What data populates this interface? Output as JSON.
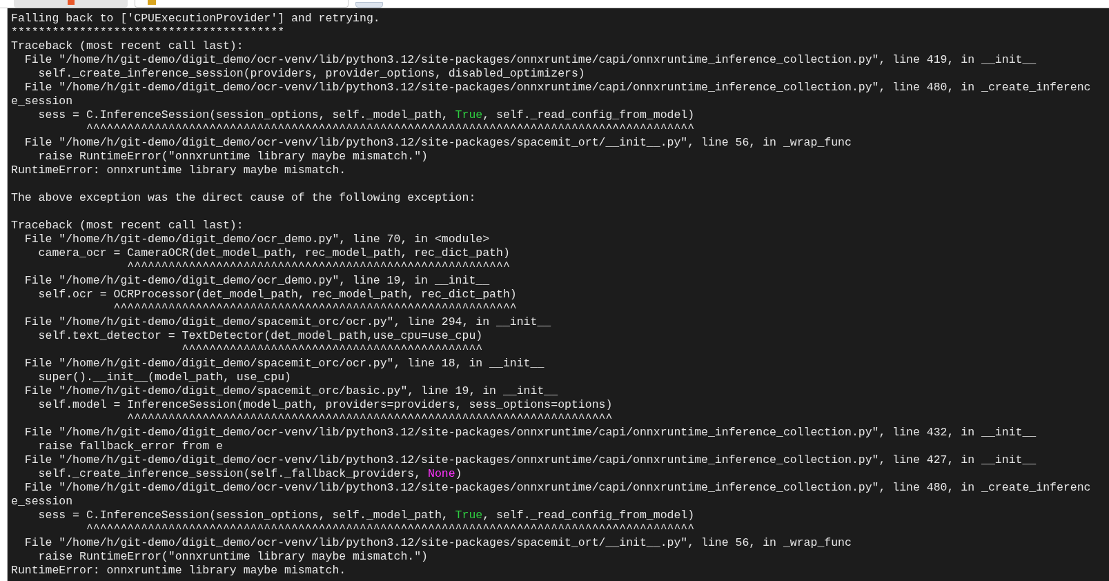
{
  "terminal": {
    "lines": [
      {
        "kind": "text",
        "parts": [
          {
            "text": "Falling back to ['CPUExecutionProvider'] and retrying."
          }
        ]
      },
      {
        "kind": "text",
        "parts": [
          {
            "text": "****************************************"
          }
        ]
      },
      {
        "kind": "text",
        "parts": [
          {
            "text": "Traceback (most recent call last):"
          }
        ]
      },
      {
        "kind": "text",
        "parts": [
          {
            "text": "  File \"/home/h/git-demo/digit_demo/ocr-venv/lib/python3.12/site-packages/onnxruntime/capi/onnxruntime_inference_collection.py\", line 419, in __init__"
          }
        ]
      },
      {
        "kind": "text",
        "parts": [
          {
            "text": "    self._create_inference_session(providers, provider_options, disabled_optimizers)"
          }
        ]
      },
      {
        "kind": "text",
        "parts": [
          {
            "text": "  File \"/home/h/git-demo/digit_demo/ocr-venv/lib/python3.12/site-packages/onnxruntime/capi/onnxruntime_inference_collection.py\", line 480, in _create_inferenc"
          }
        ]
      },
      {
        "kind": "text",
        "parts": [
          {
            "text": "e_session"
          }
        ]
      },
      {
        "kind": "text",
        "parts": [
          {
            "text": "    sess = C.InferenceSession(session_options, self._model_path, "
          },
          {
            "text": "True",
            "color": "#2ecc40"
          },
          {
            "text": ", self._read_config_from_model)"
          }
        ]
      },
      {
        "kind": "text",
        "parts": [
          {
            "text": "           ^^^^^^^^^^^^^^^^^^^^^^^^^^^^^^^^^^^^^^^^^^^^^^^^^^^^^^^^^^^^^^^^^^^^^^^^^^^^^^^^^^^^^^^^^"
          }
        ]
      },
      {
        "kind": "text",
        "parts": [
          {
            "text": "  File \"/home/h/git-demo/digit_demo/ocr-venv/lib/python3.12/site-packages/spacemit_ort/__init__.py\", line 56, in _wrap_func"
          }
        ]
      },
      {
        "kind": "text",
        "parts": [
          {
            "text": "    raise RuntimeError(\"onnxruntime library maybe mismatch.\")"
          }
        ]
      },
      {
        "kind": "text",
        "parts": [
          {
            "text": "RuntimeError: onnxruntime library maybe mismatch."
          }
        ]
      },
      {
        "kind": "blank"
      },
      {
        "kind": "text",
        "parts": [
          {
            "text": "The above exception was the direct cause of the following exception:"
          }
        ]
      },
      {
        "kind": "blank"
      },
      {
        "kind": "text",
        "parts": [
          {
            "text": "Traceback (most recent call last):"
          }
        ]
      },
      {
        "kind": "text",
        "parts": [
          {
            "text": "  File \"/home/h/git-demo/digit_demo/ocr_demo.py\", line 70, in <module>"
          }
        ]
      },
      {
        "kind": "text",
        "parts": [
          {
            "text": "    camera_ocr = CameraOCR(det_model_path, rec_model_path, rec_dict_path)"
          }
        ]
      },
      {
        "kind": "text",
        "parts": [
          {
            "text": "                 ^^^^^^^^^^^^^^^^^^^^^^^^^^^^^^^^^^^^^^^^^^^^^^^^^^^^^^^^"
          }
        ]
      },
      {
        "kind": "text",
        "parts": [
          {
            "text": "  File \"/home/h/git-demo/digit_demo/ocr_demo.py\", line 19, in __init__"
          }
        ]
      },
      {
        "kind": "text",
        "parts": [
          {
            "text": "    self.ocr = OCRProcessor(det_model_path, rec_model_path, rec_dict_path)"
          }
        ]
      },
      {
        "kind": "text",
        "parts": [
          {
            "text": "               ^^^^^^^^^^^^^^^^^^^^^^^^^^^^^^^^^^^^^^^^^^^^^^^^^^^^^^^^^^^"
          }
        ]
      },
      {
        "kind": "text",
        "parts": [
          {
            "text": "  File \"/home/h/git-demo/digit_demo/spacemit_orc/ocr.py\", line 294, in __init__"
          }
        ]
      },
      {
        "kind": "text",
        "parts": [
          {
            "text": "    self.text_detector = TextDetector(det_model_path,use_cpu=use_cpu)"
          }
        ]
      },
      {
        "kind": "text",
        "parts": [
          {
            "text": "                         ^^^^^^^^^^^^^^^^^^^^^^^^^^^^^^^^^^^^^^^^^^^^"
          }
        ]
      },
      {
        "kind": "text",
        "parts": [
          {
            "text": "  File \"/home/h/git-demo/digit_demo/spacemit_orc/ocr.py\", line 18, in __init__"
          }
        ]
      },
      {
        "kind": "text",
        "parts": [
          {
            "text": "    super().__init__(model_path, use_cpu)"
          }
        ]
      },
      {
        "kind": "text",
        "parts": [
          {
            "text": "  File \"/home/h/git-demo/digit_demo/spacemit_orc/basic.py\", line 19, in __init__"
          }
        ]
      },
      {
        "kind": "text",
        "parts": [
          {
            "text": "    self.model = InferenceSession(model_path, providers=providers, sess_options=options)"
          }
        ]
      },
      {
        "kind": "text",
        "parts": [
          {
            "text": "                 ^^^^^^^^^^^^^^^^^^^^^^^^^^^^^^^^^^^^^^^^^^^^^^^^^^^^^^^^^^^^^^^^^^^^^^^"
          }
        ]
      },
      {
        "kind": "text",
        "parts": [
          {
            "text": "  File \"/home/h/git-demo/digit_demo/ocr-venv/lib/python3.12/site-packages/onnxruntime/capi/onnxruntime_inference_collection.py\", line 432, in __init__"
          }
        ]
      },
      {
        "kind": "text",
        "parts": [
          {
            "text": "    raise fallback_error from e"
          }
        ]
      },
      {
        "kind": "text",
        "parts": [
          {
            "text": "  File \"/home/h/git-demo/digit_demo/ocr-venv/lib/python3.12/site-packages/onnxruntime/capi/onnxruntime_inference_collection.py\", line 427, in __init__"
          }
        ]
      },
      {
        "kind": "text",
        "parts": [
          {
            "text": "    self._create_inference_session(self._fallback_providers, "
          },
          {
            "text": "None",
            "color": "#ff33ff"
          },
          {
            "text": ")"
          }
        ]
      },
      {
        "kind": "text",
        "parts": [
          {
            "text": "  File \"/home/h/git-demo/digit_demo/ocr-venv/lib/python3.12/site-packages/onnxruntime/capi/onnxruntime_inference_collection.py\", line 480, in _create_inferenc"
          }
        ]
      },
      {
        "kind": "text",
        "parts": [
          {
            "text": "e_session"
          }
        ]
      },
      {
        "kind": "text",
        "parts": [
          {
            "text": "    sess = C.InferenceSession(session_options, self._model_path, "
          },
          {
            "text": "True",
            "color": "#2ecc40"
          },
          {
            "text": ", self._read_config_from_model)"
          }
        ]
      },
      {
        "kind": "text",
        "parts": [
          {
            "text": "           ^^^^^^^^^^^^^^^^^^^^^^^^^^^^^^^^^^^^^^^^^^^^^^^^^^^^^^^^^^^^^^^^^^^^^^^^^^^^^^^^^^^^^^^^^"
          }
        ]
      },
      {
        "kind": "text",
        "parts": [
          {
            "text": "  File \"/home/h/git-demo/digit_demo/ocr-venv/lib/python3.12/site-packages/spacemit_ort/__init__.py\", line 56, in _wrap_func"
          }
        ]
      },
      {
        "kind": "text",
        "parts": [
          {
            "text": "    raise RuntimeError(\"onnxruntime library maybe mismatch.\")"
          }
        ]
      },
      {
        "kind": "text",
        "parts": [
          {
            "text": "RuntimeError: onnxruntime library maybe mismatch."
          }
        ]
      }
    ]
  }
}
